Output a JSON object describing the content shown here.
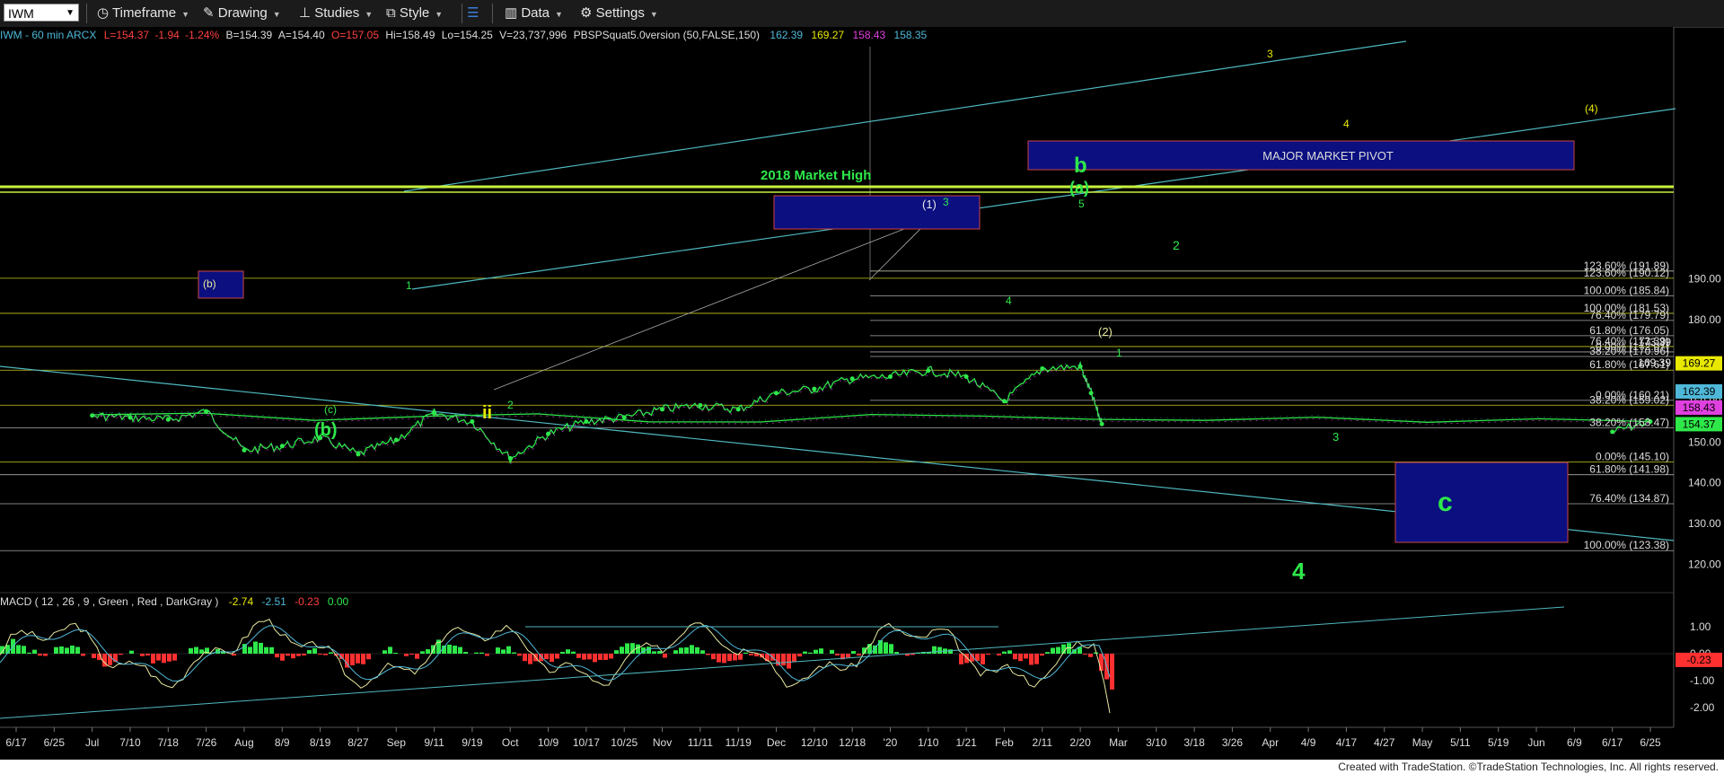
{
  "toolbar": {
    "symbol": "IWM",
    "items": [
      "Timeframe",
      "Drawing",
      "Studies",
      "Style",
      "Data",
      "Settings"
    ]
  },
  "header": {
    "symbol_info": "IWM - 60 min  ARCX",
    "last": "L=154.37",
    "change": "-1.94",
    "change_pct": "-1.24%",
    "bid": "B=154.39",
    "ask": "A=154.40",
    "open": "O=157.05",
    "high": "Hi=158.49",
    "low": "Lo=154.25",
    "volume": "V=23,737,996",
    "study": "PBSPSquat5.0version (50,FALSE,150)",
    "study_values": [
      "162.39",
      "169.27",
      "158.43",
      "158.35"
    ]
  },
  "macd": {
    "label": "MACD ( 12 , 26 , 9 , Green , Red , DarkGray )",
    "values": [
      "-2.74",
      "-2.51",
      "-0.23",
      "0.00"
    ],
    "ticks": [
      "1.00",
      "0.00",
      "-1.00",
      "-2.00"
    ],
    "current": "-0.23"
  },
  "price_badges": [
    "169.27",
    "162.39",
    "158.43",
    "154.37"
  ],
  "fib_labels": [
    "123.60% (191.89)",
    "123.60% (190.12)",
    "100.00% (185.84)",
    "100.00% (181.53)",
    "76.40% (179.79)",
    "61.80% (176.05)",
    "76.40% (173.39)",
    "0.00% (172.07)",
    "38.20% (170.96)",
    "61.80% (167.61)",
    "0.00% (160.21)",
    "38.20% (159.02)",
    "38.20% (153.47)",
    "0.00% (145.10)",
    "61.80% (141.98)",
    "76.40% (134.87)",
    "100.00% (123.38)"
  ],
  "extra_labels": [
    "173.39",
    "169.39"
  ],
  "annotations": {
    "market_high": "2018 Market High",
    "pivot": "MAJOR MARKET PIVOT",
    "waves": [
      "(b)",
      "(c)",
      "(b)",
      "1",
      "ii",
      "2",
      "(1)",
      "3",
      "4",
      "5",
      "(a)",
      "b",
      "(2)",
      "1",
      "2",
      "3",
      "4",
      "c",
      "3",
      "4",
      "(4)"
    ]
  },
  "footer": "Created with TradeStation. ©TradeStation Technologies, Inc. All rights reserved.",
  "chart_data": {
    "type": "line",
    "title": "IWM - 60 min",
    "ylabel": "",
    "ylim": [
      115,
      195
    ],
    "price_ticks": [
      120,
      130,
      140,
      150,
      160,
      170,
      180,
      190
    ],
    "x_ticks": [
      "6/17",
      "6/25",
      "Jul",
      "7/10",
      "7/18",
      "7/26",
      "Aug",
      "8/9",
      "8/19",
      "8/27",
      "Sep",
      "9/11",
      "9/19",
      "Oct",
      "10/9",
      "10/17",
      "10/25",
      "Nov",
      "11/11",
      "11/19",
      "Dec",
      "12/10",
      "12/18",
      "'20",
      "1/10",
      "1/21",
      "Feb",
      "2/11",
      "2/20",
      "Mar",
      "3/10",
      "3/18",
      "3/26",
      "Apr",
      "4/9",
      "4/17",
      "4/27",
      "May",
      "5/11",
      "5/19",
      "Jun",
      "6/9",
      "6/17",
      "6/25"
    ],
    "series": [
      {
        "name": "IWM",
        "x": [
          "6/17",
          "6/25",
          "Jul",
          "7/10",
          "7/18",
          "7/26",
          "Aug",
          "8/9",
          "8/19",
          "8/27",
          "Sep",
          "9/11",
          "9/19",
          "Oct",
          "10/9",
          "10/17",
          "10/25",
          "Nov",
          "11/11",
          "11/19",
          "Dec",
          "12/10",
          "12/18",
          "'20",
          "1/10",
          "1/21",
          "Feb",
          "2/11",
          "2/20",
          "2/24",
          "2/25"
        ],
        "values": [
          152.5,
          155,
          156.5,
          156,
          155.5,
          157.5,
          148,
          149,
          151,
          147,
          150.5,
          157,
          155,
          146,
          152,
          155,
          156,
          158,
          159,
          158,
          162,
          163,
          165.5,
          166,
          167.5,
          166,
          160,
          168,
          168.5,
          162,
          154.4
        ]
      }
    ],
    "levels": [
      191.89,
      190.12,
      185.84,
      181.53,
      179.79,
      176.05,
      173.39,
      172.07,
      170.96,
      167.61,
      160.21,
      159.02,
      153.47,
      145.1,
      141.98,
      134.87,
      123.38
    ]
  }
}
